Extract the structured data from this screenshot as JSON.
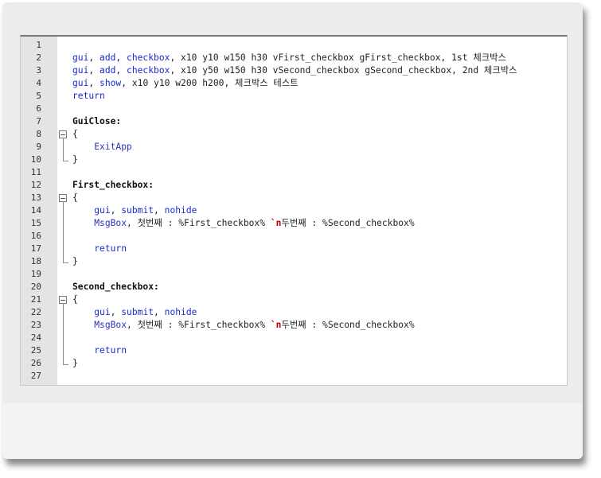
{
  "editor": {
    "lines": [
      {
        "n": "1",
        "fold": "",
        "tokens": []
      },
      {
        "n": "2",
        "fold": "",
        "tokens": [
          {
            "t": "gui",
            "c": "tk-kw"
          },
          {
            "t": ", ",
            "c": "tk-plain"
          },
          {
            "t": "add",
            "c": "tk-kw"
          },
          {
            "t": ", ",
            "c": "tk-plain"
          },
          {
            "t": "checkbox",
            "c": "tk-kw"
          },
          {
            "t": ", x10 y10 w150 h30 vFirst_checkbox gFirst_checkbox, 1st 체크박스",
            "c": "tk-plain"
          }
        ]
      },
      {
        "n": "3",
        "fold": "",
        "tokens": [
          {
            "t": "gui",
            "c": "tk-kw"
          },
          {
            "t": ", ",
            "c": "tk-plain"
          },
          {
            "t": "add",
            "c": "tk-kw"
          },
          {
            "t": ", ",
            "c": "tk-plain"
          },
          {
            "t": "checkbox",
            "c": "tk-kw"
          },
          {
            "t": ", x10 y50 w150 h30 vSecond_checkbox gSecond_checkbox, 2nd 체크박스",
            "c": "tk-plain"
          }
        ]
      },
      {
        "n": "4",
        "fold": "",
        "tokens": [
          {
            "t": "gui",
            "c": "tk-kw"
          },
          {
            "t": ", ",
            "c": "tk-plain"
          },
          {
            "t": "show",
            "c": "tk-kw"
          },
          {
            "t": ", x10 y10 w200 h200, 체크박스 테스트",
            "c": "tk-plain"
          }
        ]
      },
      {
        "n": "5",
        "fold": "",
        "tokens": [
          {
            "t": "return",
            "c": "tk-kw"
          }
        ]
      },
      {
        "n": "6",
        "fold": "",
        "tokens": []
      },
      {
        "n": "7",
        "fold": "",
        "tokens": [
          {
            "t": "GuiClose:",
            "c": "tk-label"
          }
        ]
      },
      {
        "n": "8",
        "fold": "box",
        "tokens": [
          {
            "t": "{",
            "c": "tk-plain"
          }
        ]
      },
      {
        "n": "9",
        "fold": "line",
        "tokens": [
          {
            "t": "    ",
            "c": "tk-plain"
          },
          {
            "t": "ExitApp",
            "c": "tk-fn"
          }
        ]
      },
      {
        "n": "10",
        "fold": "end",
        "tokens": [
          {
            "t": "}",
            "c": "tk-plain"
          }
        ]
      },
      {
        "n": "11",
        "fold": "",
        "tokens": []
      },
      {
        "n": "12",
        "fold": "",
        "tokens": [
          {
            "t": "First_checkbox:",
            "c": "tk-label"
          }
        ]
      },
      {
        "n": "13",
        "fold": "box",
        "tokens": [
          {
            "t": "{",
            "c": "tk-plain"
          }
        ]
      },
      {
        "n": "14",
        "fold": "line",
        "tokens": [
          {
            "t": "    ",
            "c": "tk-plain"
          },
          {
            "t": "gui",
            "c": "tk-kw"
          },
          {
            "t": ", ",
            "c": "tk-plain"
          },
          {
            "t": "submit",
            "c": "tk-kw"
          },
          {
            "t": ", ",
            "c": "tk-plain"
          },
          {
            "t": "nohide",
            "c": "tk-kw"
          }
        ]
      },
      {
        "n": "15",
        "fold": "line",
        "tokens": [
          {
            "t": "    ",
            "c": "tk-plain"
          },
          {
            "t": "MsgBox",
            "c": "tk-fn"
          },
          {
            "t": ", 첫번째 : %First_checkbox% ",
            "c": "tk-plain"
          },
          {
            "t": "`n",
            "c": "tk-esc"
          },
          {
            "t": "두번째 : %Second_checkbox%",
            "c": "tk-plain"
          }
        ]
      },
      {
        "n": "16",
        "fold": "line",
        "tokens": []
      },
      {
        "n": "17",
        "fold": "line",
        "tokens": [
          {
            "t": "    ",
            "c": "tk-plain"
          },
          {
            "t": "return",
            "c": "tk-kw"
          }
        ]
      },
      {
        "n": "18",
        "fold": "end",
        "tokens": [
          {
            "t": "}",
            "c": "tk-plain"
          }
        ]
      },
      {
        "n": "19",
        "fold": "",
        "tokens": []
      },
      {
        "n": "20",
        "fold": "",
        "tokens": [
          {
            "t": "Second_checkbox:",
            "c": "tk-label"
          }
        ]
      },
      {
        "n": "21",
        "fold": "box",
        "tokens": [
          {
            "t": "{",
            "c": "tk-plain"
          }
        ]
      },
      {
        "n": "22",
        "fold": "line",
        "tokens": [
          {
            "t": "    ",
            "c": "tk-plain"
          },
          {
            "t": "gui",
            "c": "tk-kw"
          },
          {
            "t": ", ",
            "c": "tk-plain"
          },
          {
            "t": "submit",
            "c": "tk-kw"
          },
          {
            "t": ", ",
            "c": "tk-plain"
          },
          {
            "t": "nohide",
            "c": "tk-kw"
          }
        ]
      },
      {
        "n": "23",
        "fold": "line",
        "tokens": [
          {
            "t": "    ",
            "c": "tk-plain"
          },
          {
            "t": "MsgBox",
            "c": "tk-fn"
          },
          {
            "t": ", 첫번째 : %First_checkbox% ",
            "c": "tk-plain"
          },
          {
            "t": "`n",
            "c": "tk-esc"
          },
          {
            "t": "두번째 : %Second_checkbox%",
            "c": "tk-plain"
          }
        ]
      },
      {
        "n": "24",
        "fold": "line",
        "tokens": []
      },
      {
        "n": "25",
        "fold": "line",
        "tokens": [
          {
            "t": "    ",
            "c": "tk-plain"
          },
          {
            "t": "return",
            "c": "tk-kw"
          }
        ]
      },
      {
        "n": "26",
        "fold": "end",
        "tokens": [
          {
            "t": "}",
            "c": "tk-plain"
          }
        ]
      },
      {
        "n": "27",
        "fold": "",
        "tokens": []
      }
    ]
  },
  "colors": {
    "keyword": "#1a2bd0",
    "escape": "#c00000",
    "gutter": "#e4e4e4"
  }
}
